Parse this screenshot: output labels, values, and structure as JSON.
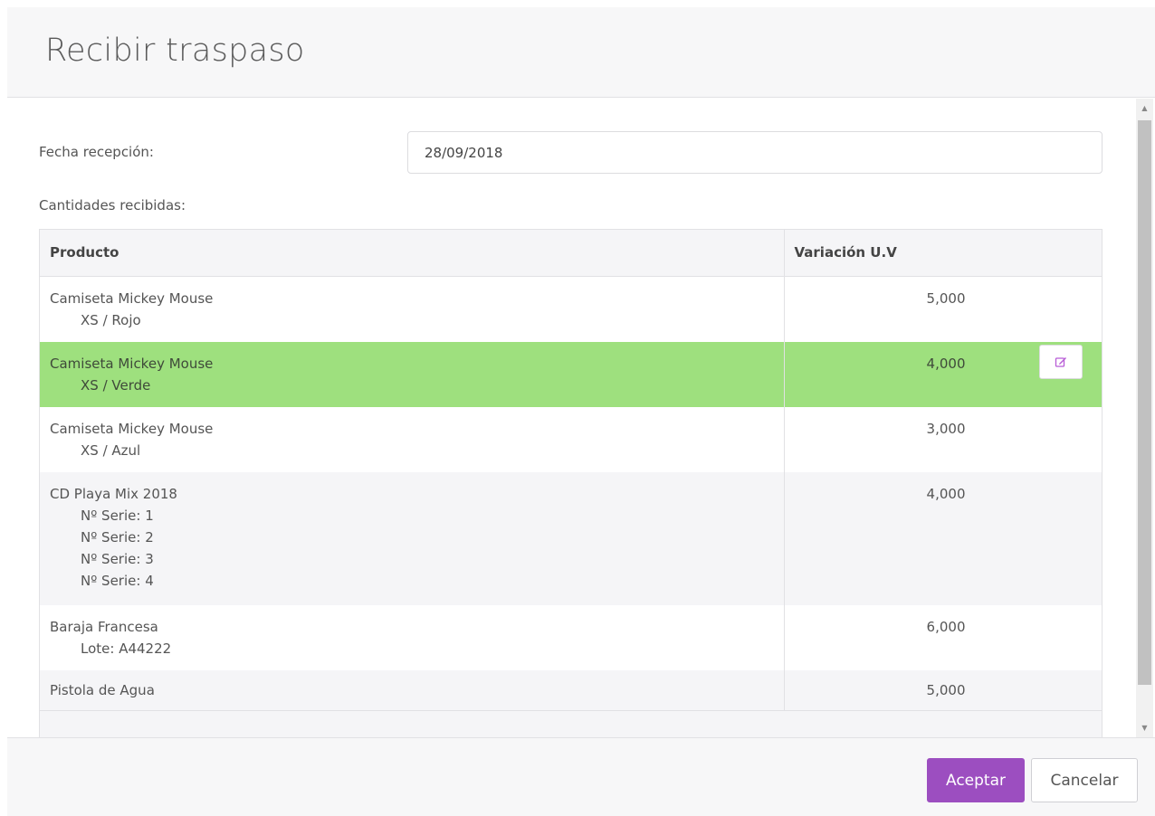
{
  "header": {
    "title": "Recibir traspaso"
  },
  "form": {
    "date_label": "Fecha recepción:",
    "date_value": "28/09/2018",
    "quantities_label": "Cantidades recibidas:"
  },
  "table": {
    "columns": [
      "Producto",
      "Variación U.V"
    ],
    "rows": [
      {
        "product": "Camiseta Mickey Mouse",
        "details": [
          "XS / Rojo"
        ],
        "qty": "5,000"
      },
      {
        "product": "Camiseta Mickey Mouse",
        "details": [
          "XS / Verde"
        ],
        "qty": "4,000",
        "selected": true
      },
      {
        "product": "Camiseta Mickey Mouse",
        "details": [
          "XS / Azul"
        ],
        "qty": "3,000"
      },
      {
        "product": "CD Playa Mix 2018",
        "details": [
          "Nº Serie: 1",
          "Nº Serie: 2",
          "Nº Serie: 3",
          "Nº Serie: 4"
        ],
        "qty": "4,000"
      },
      {
        "product": "Baraja Francesa",
        "details": [
          "Lote: A44222"
        ],
        "qty": "6,000"
      },
      {
        "product": "Pistola de Agua",
        "details": [],
        "qty": "5,000"
      }
    ],
    "edit_icon": "edit-icon"
  },
  "footer": {
    "accept_label": "Aceptar",
    "cancel_label": "Cancelar"
  },
  "colors": {
    "accent": "#9c4ec0",
    "selected_row": "#9ee07e"
  }
}
